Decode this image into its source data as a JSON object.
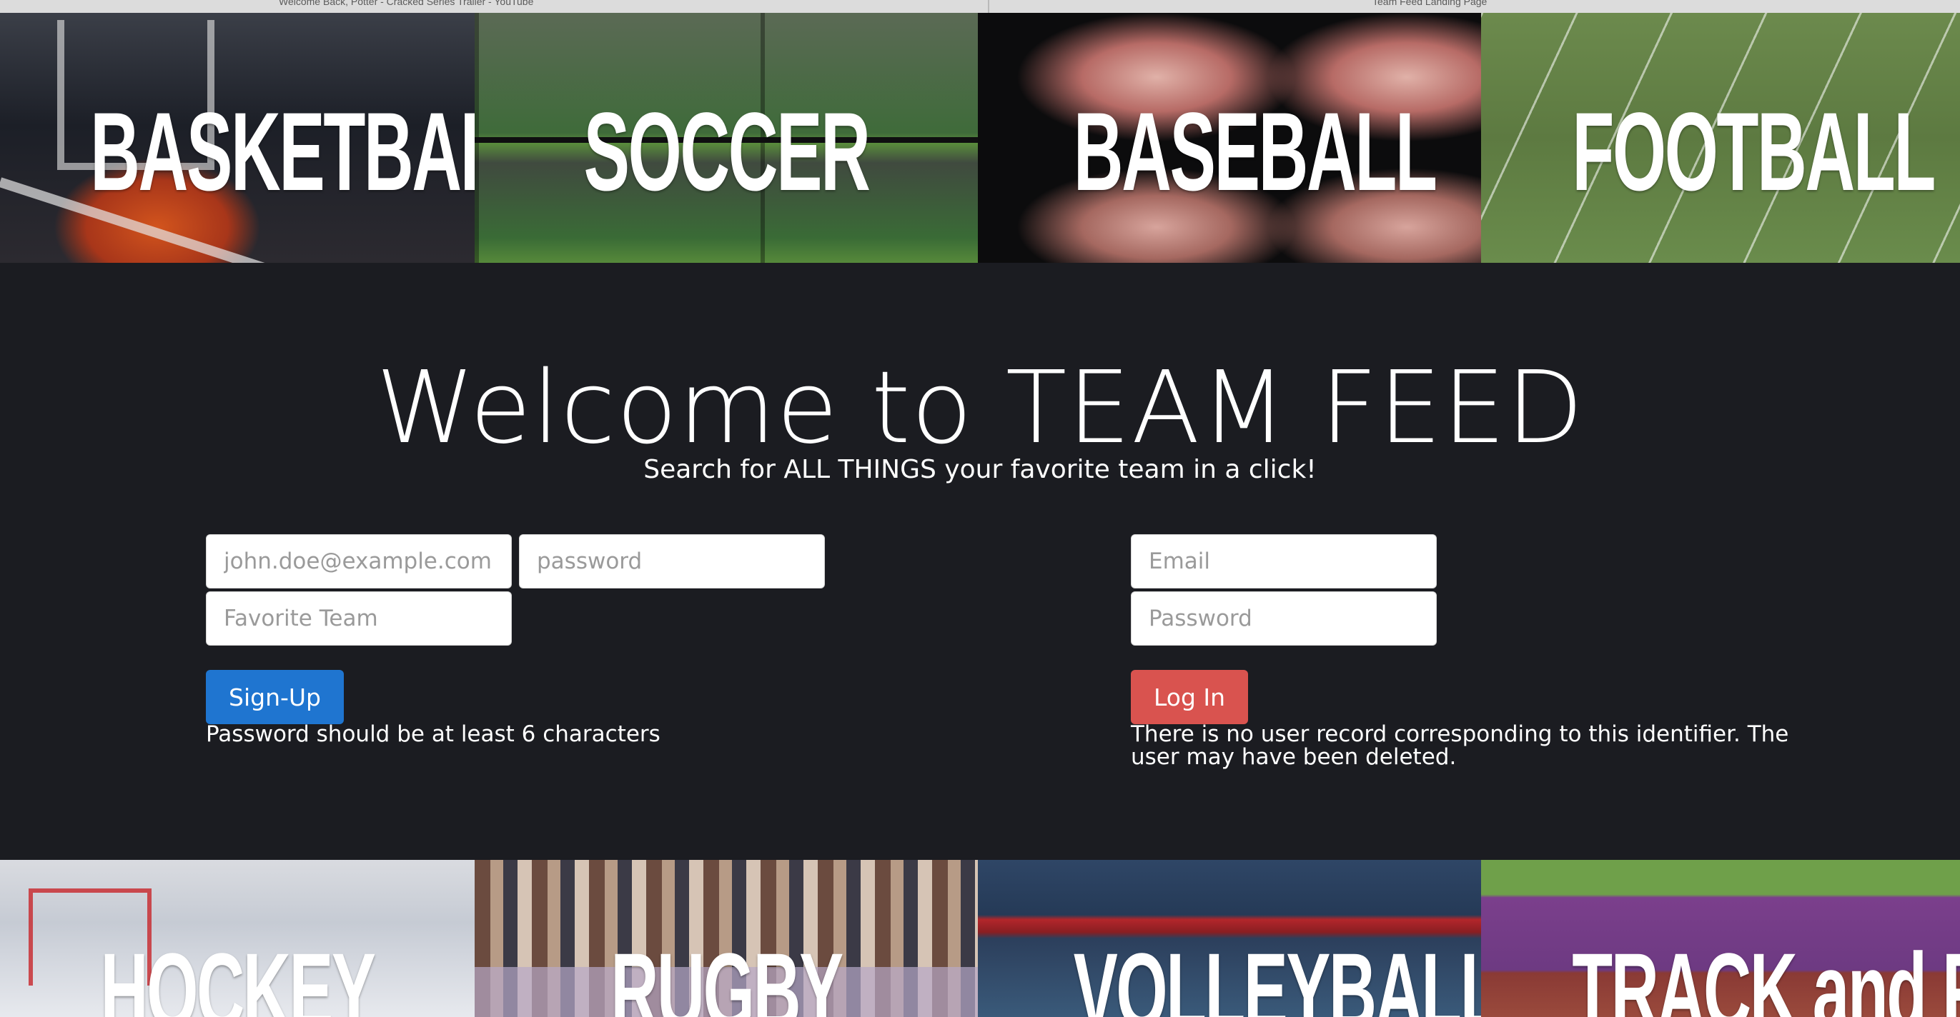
{
  "browser": {
    "tab_left": "Welcome Back, Potter - Cracked Series Trailer - YouTube",
    "tab_right": "Team Feed Landing Page"
  },
  "sports_top": [
    "BASKETBALL",
    "SOCCER",
    "BASEBALL",
    "FOOTBALL"
  ],
  "sports_bottom": [
    "HOCKEY",
    "RUGBY",
    "VOLLEYBALL",
    "TRACK and FIELD"
  ],
  "hero": {
    "title": "Welcome to TEAM FEED",
    "subtitle": "Search for ALL THINGS your favorite team in a click!"
  },
  "signup": {
    "email_placeholder": "john.doe@example.com",
    "password_placeholder": "password",
    "team_placeholder": "Favorite Team",
    "button_label": "Sign-Up",
    "error": "Password should be at least 6 characters"
  },
  "login": {
    "email_placeholder": "Email",
    "password_placeholder": "Password",
    "button_label": "Log In",
    "error_line1": "There is no user record corresponding to this identifier. The",
    "error_line2": "user may have been deleted."
  },
  "colors": {
    "background": "#1b1c21",
    "signup_button": "#1f75d0",
    "login_button": "#d9534f"
  }
}
